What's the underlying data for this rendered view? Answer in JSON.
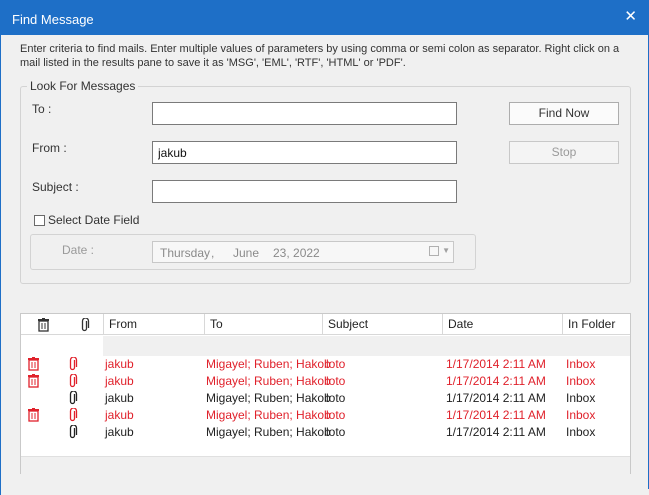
{
  "window": {
    "title": "Find Message",
    "close_glyph": "✕"
  },
  "instructions": "Enter criteria to find mails. Enter multiple values of parameters by using comma or semi colon as separator. Right click on a mail listed in the results pane to save it as 'MSG', 'EML', 'RTF', 'HTML' or 'PDF'.",
  "look_for": {
    "group_title": "Look For Messages",
    "to_label": "To :",
    "to_value": "",
    "from_label": "From :",
    "from_value": "jakub",
    "subject_label": "Subject :",
    "subject_value": "",
    "select_date_label": "Select Date Field",
    "select_date_checked": false,
    "date_label": "Date :",
    "date_weekday": "Thursday",
    "date_sep": ",",
    "date_month": "June",
    "date_day_year": "23, 2022"
  },
  "buttons": {
    "find_now": "Find Now",
    "stop": "Stop"
  },
  "results": {
    "icons": {
      "delete": "trash-icon",
      "attachment": "paperclip-icon"
    },
    "colors": {
      "flagged": "#e0212b",
      "normal": "#222222"
    },
    "columns": [
      "From",
      "To",
      "Subject",
      "Date",
      "In Folder"
    ],
    "rows": [
      {
        "deleted": true,
        "attachment_red": true,
        "from": "jakub",
        "to": "Migayel; Ruben; Hakob",
        "subject": "loto",
        "date": "1/17/2014 2:11 AM",
        "folder": "Inbox",
        "style": "red"
      },
      {
        "deleted": true,
        "attachment_red": true,
        "from": "jakub",
        "to": "Migayel; Ruben; Hakob",
        "subject": "loto",
        "date": "1/17/2014 2:11 AM",
        "folder": "Inbox",
        "style": "red"
      },
      {
        "deleted": false,
        "attachment_red": false,
        "from": "jakub",
        "to": "Migayel; Ruben; Hakob",
        "subject": "loto",
        "date": "1/17/2014 2:11 AM",
        "folder": "Inbox",
        "style": "black"
      },
      {
        "deleted": true,
        "attachment_red": true,
        "from": "jakub",
        "to": "Migayel; Ruben; Hakob",
        "subject": "loto",
        "date": "1/17/2014 2:11 AM",
        "folder": "Inbox",
        "style": "red"
      },
      {
        "deleted": false,
        "attachment_red": false,
        "from": "jakub",
        "to": "Migayel; Ruben; Hakob",
        "subject": "loto",
        "date": "1/17/2014 2:11 AM",
        "folder": "Inbox",
        "style": "black"
      }
    ]
  }
}
